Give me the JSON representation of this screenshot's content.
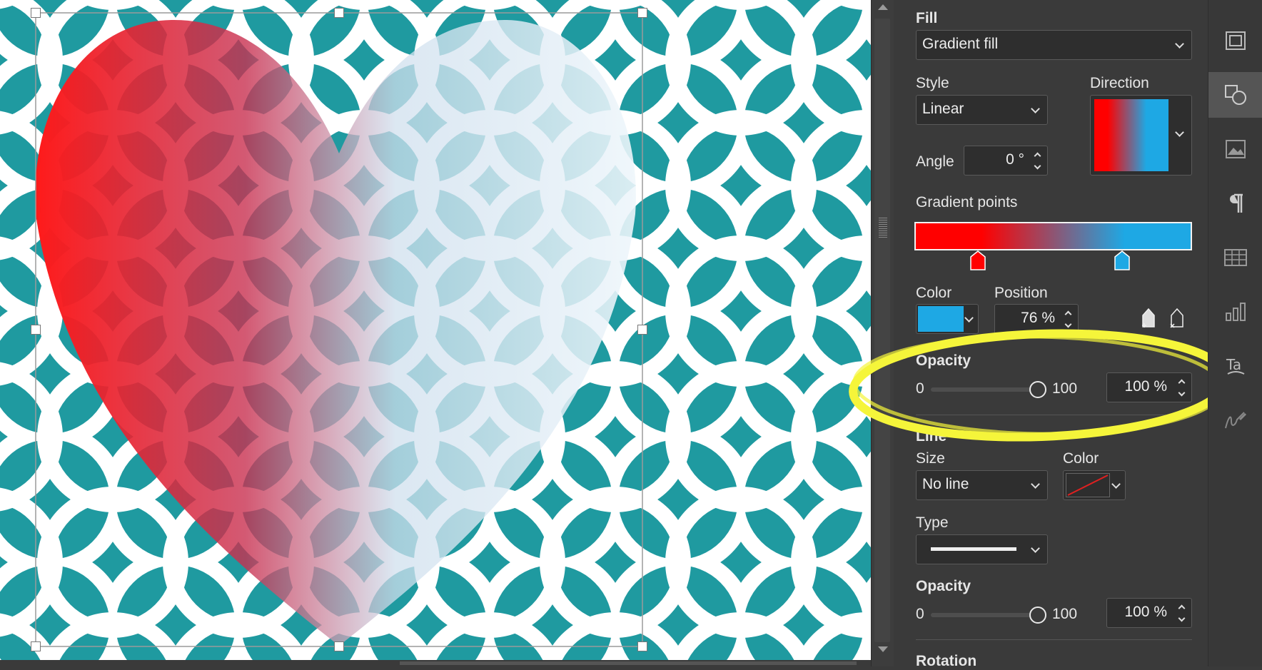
{
  "fill": {
    "section_label": "Fill",
    "fill_type": "Gradient fill",
    "style_label": "Style",
    "style_value": "Linear",
    "direction_label": "Direction",
    "angle_label": "Angle",
    "angle_value": "0 °",
    "gradient_points_label": "Gradient points",
    "color_label": "Color",
    "position_label": "Position",
    "position_value": "76 %",
    "opacity_label": "Opacity",
    "opacity_min": "0",
    "opacity_max": "100",
    "opacity_value": "100 %",
    "opacity_level": 1.0,
    "gradient_start_color": "#ff0000",
    "gradient_end_color": "#1ea8e4",
    "selected_color": "#1ea8e4",
    "stop1_position": 0.24,
    "stop2_position": 0.76
  },
  "line": {
    "section_label": "Line",
    "size_label": "Size",
    "size_value": "No line",
    "color_label": "Color",
    "type_label": "Type",
    "opacity_label": "Opacity",
    "opacity_min": "0",
    "opacity_max": "100",
    "opacity_value": "100 %",
    "opacity_level": 1.0
  },
  "rotation_label": "Rotation",
  "sidebar_icons": [
    "slide-settings-icon",
    "shape-settings-icon",
    "image-settings-icon",
    "paragraph-icon",
    "table-icon",
    "chart-icon",
    "text-art-icon",
    "signature-icon"
  ],
  "canvas": {
    "background_color": "#1f9aa0",
    "pattern_color": "#ffffff"
  },
  "highlight_color": "#f5f53a"
}
